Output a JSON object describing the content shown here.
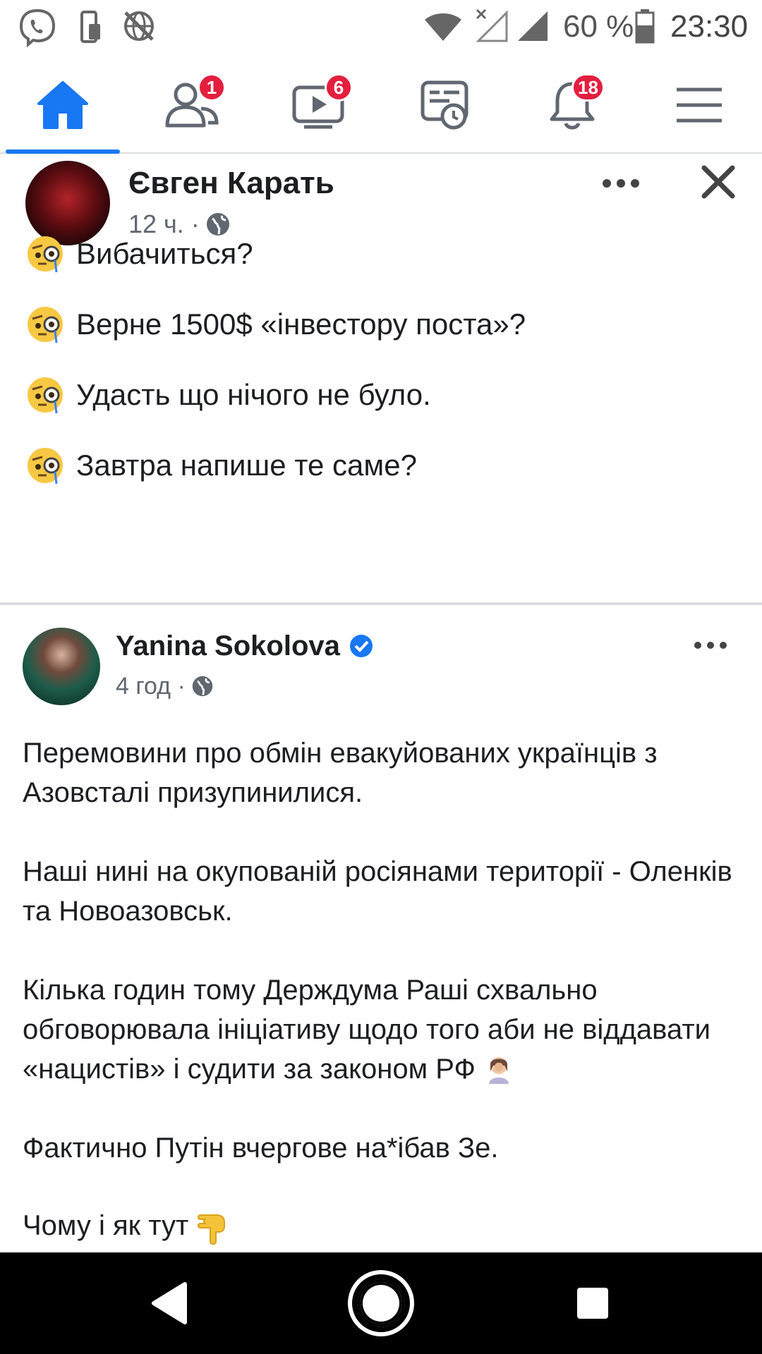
{
  "status_bar": {
    "battery": "60 %",
    "time": "23:30",
    "icons": [
      "viber-icon",
      "phone-sim-icon",
      "globe-off-icon",
      "wifi-icon",
      "signal-off-icon",
      "signal-icon",
      "battery-icon"
    ]
  },
  "nav": {
    "items": [
      {
        "name": "home",
        "icon": "home-icon",
        "badge": ""
      },
      {
        "name": "friends",
        "icon": "friends-icon",
        "badge": "1"
      },
      {
        "name": "watch",
        "icon": "watch-icon",
        "badge": "6"
      },
      {
        "name": "memories",
        "icon": "memories-icon",
        "badge": ""
      },
      {
        "name": "notifications",
        "icon": "bell-icon",
        "badge": "18"
      },
      {
        "name": "menu",
        "icon": "menu-icon",
        "badge": ""
      }
    ],
    "accent": "#1877f2"
  },
  "post1": {
    "author": "Євген Карать",
    "time": "12 ч. ·",
    "lines": [
      "Вибачиться?",
      "Верне 1500$ «інвестору поста»?",
      "Удасть що нічого не було.",
      "Завтра напише те саме?"
    ]
  },
  "post2": {
    "author": "Yanina Sokolova",
    "time": "4 год ·",
    "paragraphs": [
      "Перемовини про обмін евакуйованих українців з Азовсталі призупинилися.",
      "Наші нині на окупованій росіянами території - Оленків та Новоазовськ.",
      "Кілька годин тому Держдума Раші схвально обговорювала ініціативу щодо того аби не віддавати «нацистів» і судити за законом РФ",
      "Фактично Путін вчергове на*ібав Зе.",
      "Чому і як тут"
    ]
  }
}
